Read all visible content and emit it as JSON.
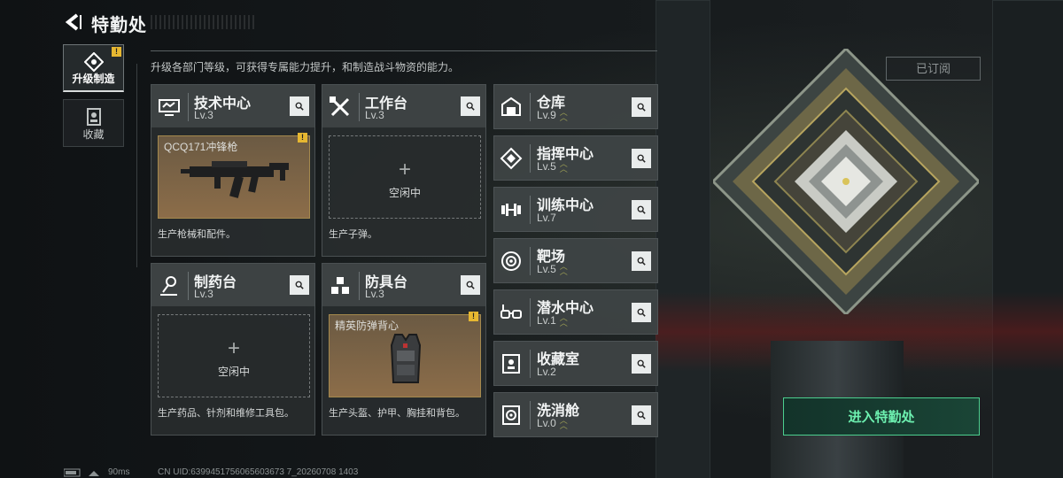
{
  "header": {
    "title": "特勤处"
  },
  "tabs": [
    {
      "label": "升级制造",
      "active": true,
      "icon": "build-icon",
      "badge": "!"
    },
    {
      "label": "收藏",
      "active": false,
      "icon": "collection-icon"
    }
  ],
  "subtitle": "升级各部门等级，可获得专属能力提升，和制造战斗物资的能力。",
  "panels": [
    {
      "name": "技术中心",
      "level": "Lv.3",
      "icon": "tech-center-icon",
      "slot": {
        "state": "filled",
        "item": "QCQ171冲锋枪",
        "badge": "!"
      },
      "desc": "生产枪械和配件。"
    },
    {
      "name": "工作台",
      "level": "Lv.3",
      "icon": "workbench-icon",
      "slot": {
        "state": "empty",
        "plus": "+",
        "idle": "空闲中"
      },
      "desc": "生产子弹。"
    },
    {
      "name": "制药台",
      "level": "Lv.3",
      "icon": "pharmacy-icon",
      "slot": {
        "state": "empty",
        "plus": "+",
        "idle": "空闲中"
      },
      "desc": "生产药品、针剂和维修工具包。"
    },
    {
      "name": "防具台",
      "level": "Lv.3",
      "icon": "armor-bench-icon",
      "slot": {
        "state": "filled",
        "item": "精英防弹背心",
        "badge": "!"
      },
      "desc": "生产头盔、护甲、胸挂和背包。"
    }
  ],
  "facilities": [
    {
      "name": "仓库",
      "level": "Lv.9",
      "icon": "warehouse-icon",
      "upgradable": true
    },
    {
      "name": "指挥中心",
      "level": "Lv.5",
      "icon": "command-center-icon",
      "upgradable": true
    },
    {
      "name": "训练中心",
      "level": "Lv.7",
      "icon": "training-center-icon",
      "upgradable": false
    },
    {
      "name": "靶场",
      "level": "Lv.5",
      "icon": "shooting-range-icon",
      "upgradable": true
    },
    {
      "name": "潜水中心",
      "level": "Lv.1",
      "icon": "diving-center-icon",
      "upgradable": true
    },
    {
      "name": "收藏室",
      "level": "Lv.2",
      "icon": "collection-room-icon",
      "upgradable": false
    },
    {
      "name": "洗消舱",
      "level": "Lv.0",
      "icon": "decon-chamber-icon",
      "upgradable": true
    }
  ],
  "subscribed_label": "已订阅",
  "enter_label": "进入特勤处",
  "footer": {
    "ping": "90ms",
    "uid": "CN UID:6399451756065603673 7_20260708 1403"
  },
  "colors": {
    "accent_green": "#4ccf8f",
    "badge_yellow": "#e6b731",
    "slot_gold": "#a5894d"
  }
}
